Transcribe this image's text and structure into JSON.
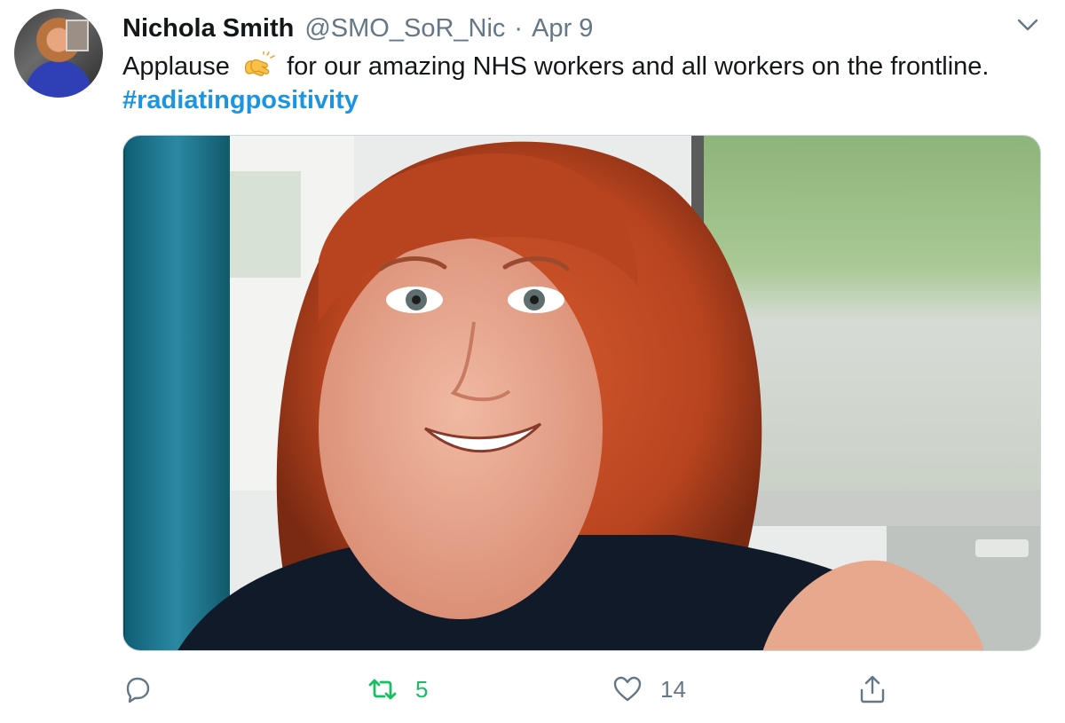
{
  "tweet": {
    "author_name": "Nichola Smith",
    "handle": "@SMO_SoR_Nic",
    "separator": "·",
    "date": "Apr 9",
    "text_before": "Applause",
    "text_after": "for our amazing NHS workers and all workers on the frontline.",
    "hashtag": "#radiatingpositivity",
    "emoji_icon": "clapping-hands-icon"
  },
  "actions": {
    "reply_icon": "reply-icon",
    "retweet_icon": "retweet-icon",
    "retweet_count": "5",
    "like_icon": "heart-icon",
    "like_count": "14",
    "share_icon": "share-icon"
  },
  "colors": {
    "text": "#14171a",
    "secondary": "#657786",
    "link": "#1b95e0",
    "retweet_active": "#17bf63"
  }
}
